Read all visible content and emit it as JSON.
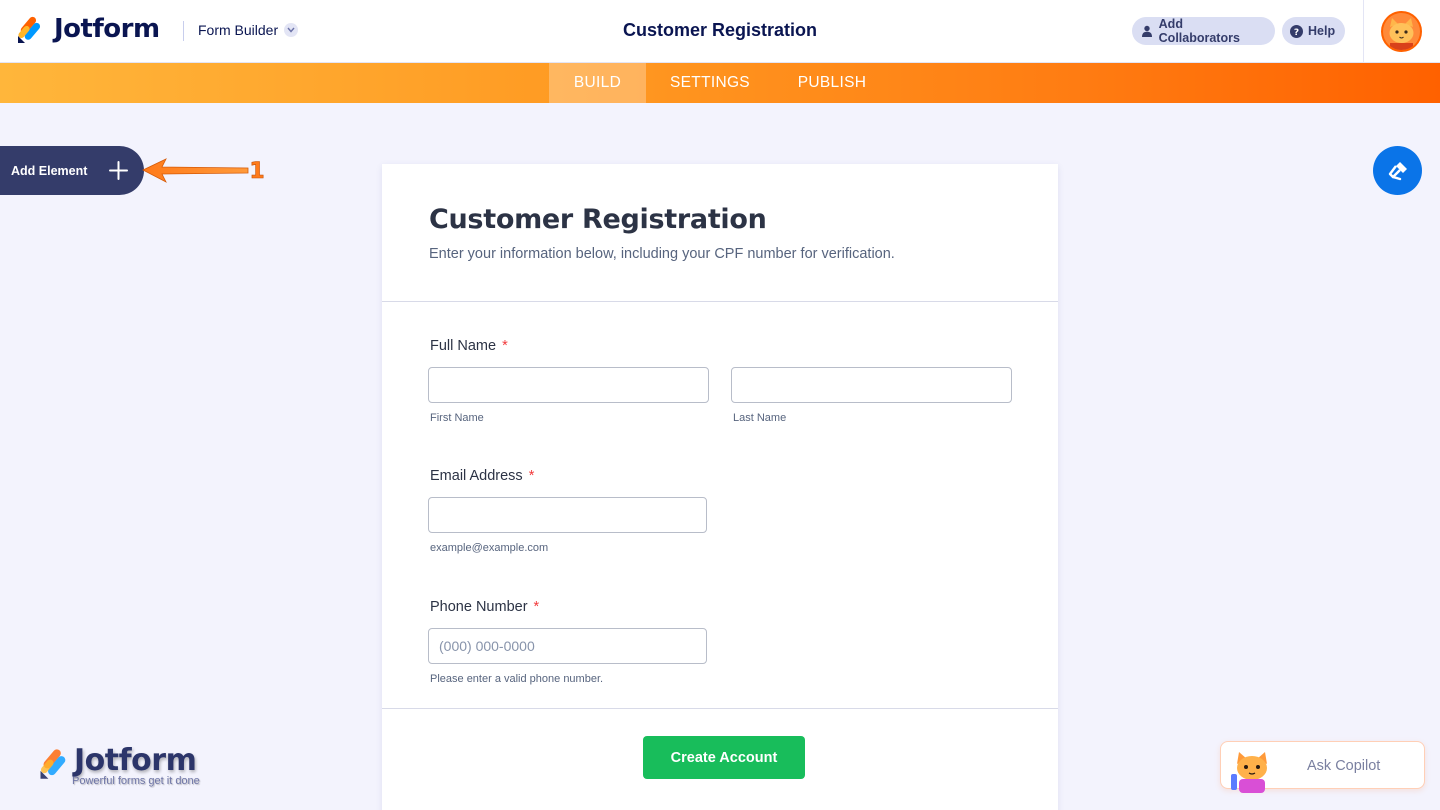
{
  "header": {
    "logo_text": "Jotform",
    "form_builder_label": "Form Builder",
    "form_title": "Customer Registration",
    "add_collaborators_label": "Add Collaborators",
    "help_label": "Help"
  },
  "tabs": [
    {
      "label": "BUILD",
      "active": true
    },
    {
      "label": "SETTINGS",
      "active": false
    },
    {
      "label": "PUBLISH",
      "active": false
    }
  ],
  "sidebar": {
    "add_element_label": "Add Element"
  },
  "annotation": {
    "number": "1",
    "color": "#ff7a1a"
  },
  "form": {
    "title": "Customer Registration",
    "subtitle": "Enter your information below, including your CPF number for verification.",
    "fields": {
      "full_name": {
        "label": "Full Name",
        "required_mark": "*",
        "first_sublabel": "First Name",
        "last_sublabel": "Last Name",
        "first_value": "",
        "last_value": ""
      },
      "email": {
        "label": "Email Address",
        "required_mark": "*",
        "sublabel": "example@example.com",
        "value": ""
      },
      "phone": {
        "label": "Phone Number",
        "required_mark": "*",
        "placeholder": "(000) 000-0000",
        "sublabel": "Please enter a valid phone number."
      }
    },
    "submit_label": "Create Account"
  },
  "watermark": {
    "text": "Jotform",
    "tagline": "Powerful forms get it done"
  },
  "copilot": {
    "label": "Ask Copilot"
  },
  "colors": {
    "accent_orange": "#ff6100",
    "tab_gradient_start": "#ffb63b",
    "submit_green": "#18bd5b",
    "paint_blue": "#0a74e8",
    "navy": "#0a1551",
    "add_element_bg": "#343c6a"
  },
  "icons": {
    "logo": "jotform-logo-icon",
    "chevron": "chevron-down-icon",
    "collaborator": "user-icon",
    "help": "question-circle-icon",
    "avatar": "cat-avatar-icon",
    "plus": "plus-icon",
    "paint": "paint-roller-icon",
    "copilot": "copilot-cat-icon"
  }
}
